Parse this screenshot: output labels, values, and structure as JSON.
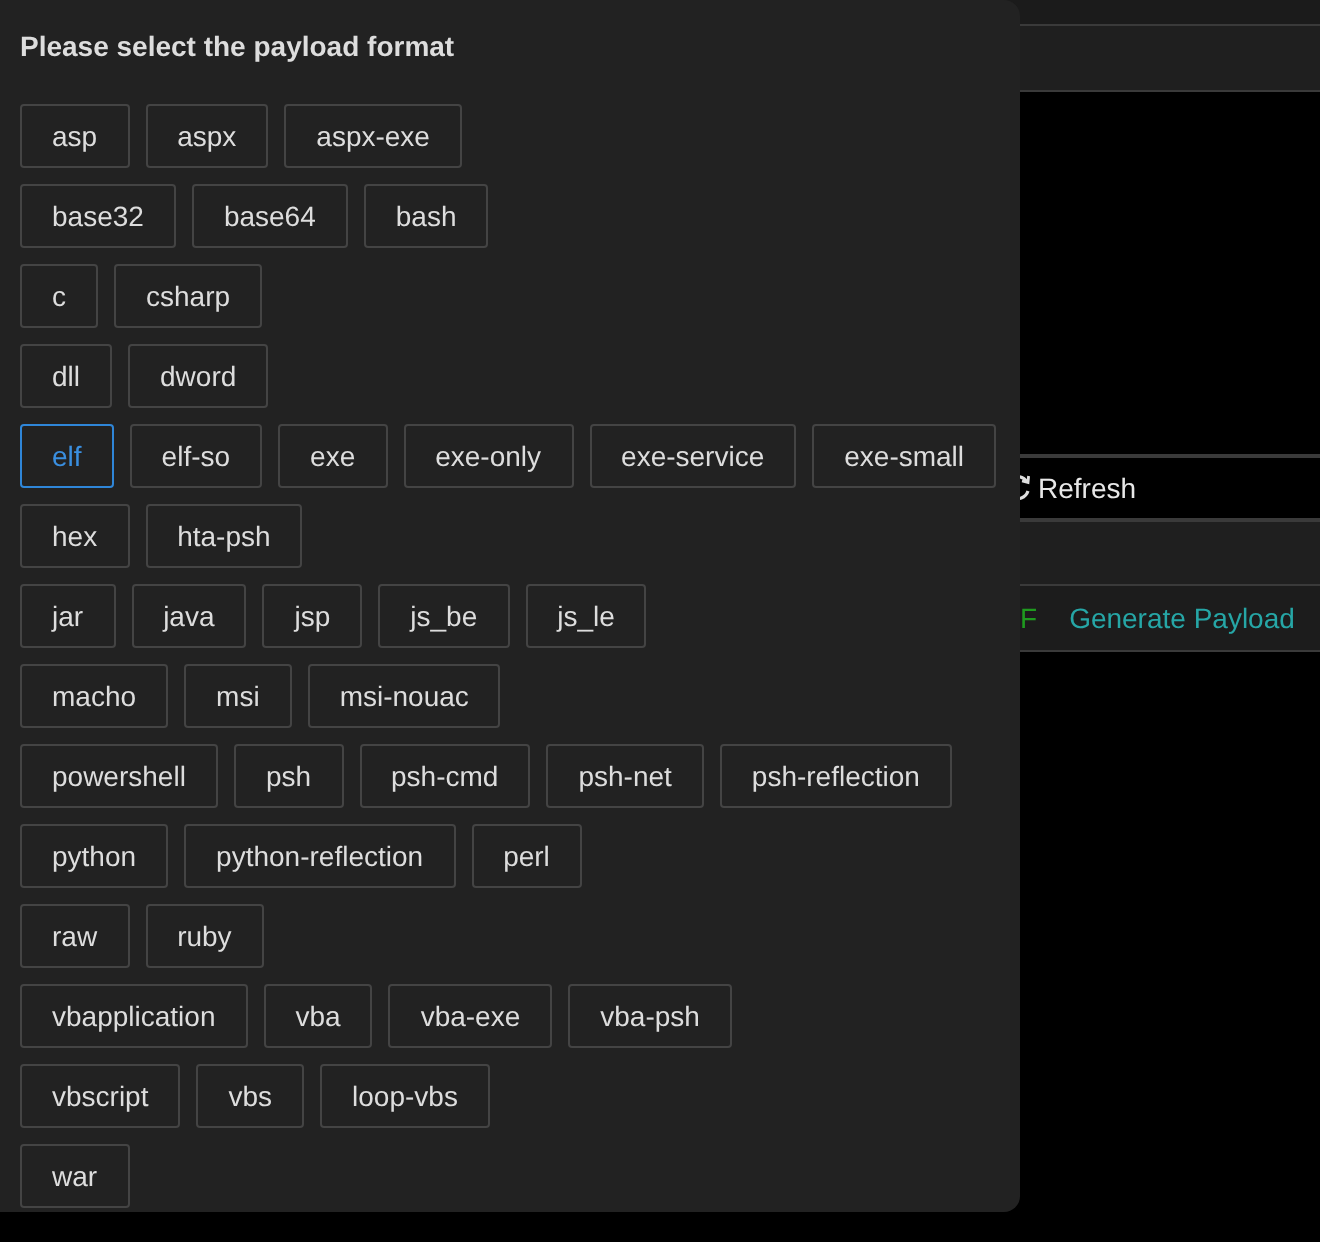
{
  "background": {
    "refresh_button": {
      "label": "Refresh"
    },
    "format_label": "F",
    "generate_link": "Generate Payload"
  },
  "dialog": {
    "title": "Please select the payload format",
    "groups": [
      {
        "options": [
          {
            "label": "asp",
            "selected": false
          },
          {
            "label": "aspx",
            "selected": false
          },
          {
            "label": "aspx-exe",
            "selected": false
          }
        ]
      },
      {
        "options": [
          {
            "label": "base32",
            "selected": false
          },
          {
            "label": "base64",
            "selected": false
          },
          {
            "label": "bash",
            "selected": false
          }
        ]
      },
      {
        "options": [
          {
            "label": "c",
            "selected": false
          },
          {
            "label": "csharp",
            "selected": false
          }
        ]
      },
      {
        "options": [
          {
            "label": "dll",
            "selected": false
          },
          {
            "label": "dword",
            "selected": false
          }
        ]
      },
      {
        "options": [
          {
            "label": "elf",
            "selected": true
          },
          {
            "label": "elf-so",
            "selected": false
          },
          {
            "label": "exe",
            "selected": false
          },
          {
            "label": "exe-only",
            "selected": false
          },
          {
            "label": "exe-service",
            "selected": false
          },
          {
            "label": "exe-small",
            "selected": false
          }
        ]
      },
      {
        "options": [
          {
            "label": "hex",
            "selected": false
          },
          {
            "label": "hta-psh",
            "selected": false
          }
        ]
      },
      {
        "options": [
          {
            "label": "jar",
            "selected": false
          },
          {
            "label": "java",
            "selected": false
          },
          {
            "label": "jsp",
            "selected": false
          },
          {
            "label": "js_be",
            "selected": false
          },
          {
            "label": "js_le",
            "selected": false
          }
        ]
      },
      {
        "options": [
          {
            "label": "macho",
            "selected": false
          },
          {
            "label": "msi",
            "selected": false
          },
          {
            "label": "msi-nouac",
            "selected": false
          }
        ]
      },
      {
        "options": [
          {
            "label": "powershell",
            "selected": false
          },
          {
            "label": "psh",
            "selected": false
          },
          {
            "label": "psh-cmd",
            "selected": false
          },
          {
            "label": "psh-net",
            "selected": false
          },
          {
            "label": "psh-reflection",
            "selected": false
          }
        ]
      },
      {
        "options": [
          {
            "label": "python",
            "selected": false
          },
          {
            "label": "python-reflection",
            "selected": false
          },
          {
            "label": "perl",
            "selected": false
          }
        ]
      },
      {
        "options": [
          {
            "label": "raw",
            "selected": false
          },
          {
            "label": "ruby",
            "selected": false
          }
        ]
      },
      {
        "options": [
          {
            "label": "vbapplication",
            "selected": false
          },
          {
            "label": "vba",
            "selected": false
          },
          {
            "label": "vba-exe",
            "selected": false
          },
          {
            "label": "vba-psh",
            "selected": false
          }
        ]
      },
      {
        "options": [
          {
            "label": "vbscript",
            "selected": false
          },
          {
            "label": "vbs",
            "selected": false
          },
          {
            "label": "loop-vbs",
            "selected": false
          }
        ]
      },
      {
        "options": [
          {
            "label": "war",
            "selected": false
          }
        ]
      }
    ]
  }
}
